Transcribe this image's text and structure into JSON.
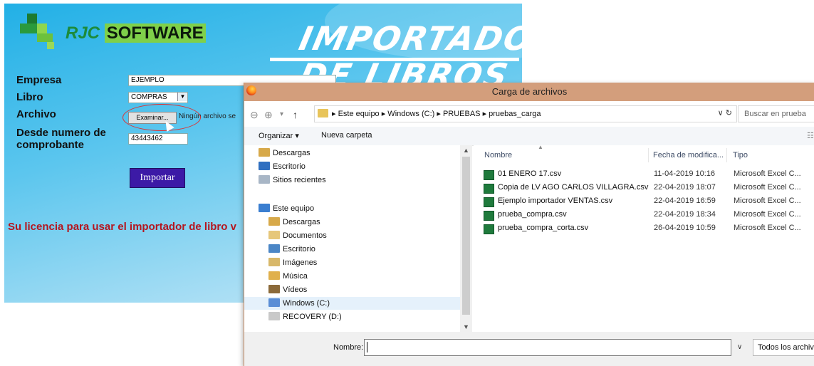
{
  "app": {
    "brand_rjc": "RJC",
    "brand_software": "SOFTWARE",
    "title_line1": "IMPORTADOR",
    "title_line2": "DE LIBROS",
    "labels": {
      "empresa": "Empresa",
      "libro": "Libro",
      "archivo": "Archivo",
      "desde1": "Desde numero de",
      "desde2": "comprobante"
    },
    "empresa_value": "EJEMPLO",
    "libro_value": "COMPRAS",
    "examinar_label": "Examinar...",
    "archivo_status": "Ningún archivo se",
    "comprobante_value": "43443462",
    "importar_label": "Importar",
    "license_text": "Su licencia para usar el importador de libro v"
  },
  "dialog": {
    "title": "Carga de archivos",
    "breadcrumb": "▸  Este equipo  ▸  Windows (C:)  ▸  PRUEBAS  ▸  pruebas_carga",
    "search_placeholder": "Buscar en prueba",
    "toolbar": {
      "organizar": "Organizar ▾",
      "nueva_carpeta": "Nueva carpeta"
    },
    "nav_items": [
      {
        "label": "Descargas",
        "icon": "download-folder-icon"
      },
      {
        "label": "Escritorio",
        "icon": "desktop-icon"
      },
      {
        "label": "Sitios recientes",
        "icon": "recent-places-icon"
      },
      {
        "label": "Este equipo",
        "icon": "computer-icon"
      },
      {
        "label": "Descargas",
        "icon": "download-folder-icon"
      },
      {
        "label": "Documentos",
        "icon": "documents-icon"
      },
      {
        "label": "Escritorio",
        "icon": "desktop-folder-icon"
      },
      {
        "label": "Imágenes",
        "icon": "pictures-icon"
      },
      {
        "label": "Música",
        "icon": "music-icon"
      },
      {
        "label": "Vídeos",
        "icon": "videos-icon"
      },
      {
        "label": "Windows (C:)",
        "icon": "windows-drive-icon"
      },
      {
        "label": "RECOVERY (D:)",
        "icon": "drive-icon"
      }
    ],
    "columns": {
      "nombre": "Nombre",
      "fecha": "Fecha de modifica...",
      "tipo": "Tipo"
    },
    "files": [
      {
        "name": "01 ENERO 17.csv",
        "date": "11-04-2019 10:16",
        "type": "Microsoft Excel C..."
      },
      {
        "name": "Copia de LV AGO CARLOS VILLAGRA.csv",
        "date": "22-04-2019 18:07",
        "type": "Microsoft Excel C..."
      },
      {
        "name": "Ejemplo importador VENTAS.csv",
        "date": "22-04-2019 16:59",
        "type": "Microsoft Excel C..."
      },
      {
        "name": "prueba_compra.csv",
        "date": "22-04-2019 18:34",
        "type": "Microsoft Excel C..."
      },
      {
        "name": "prueba_compra_corta.csv",
        "date": "26-04-2019 10:59",
        "type": "Microsoft Excel C..."
      }
    ],
    "nombre_label": "Nombre:",
    "filter_label": "Todos los archiv",
    "colors": {
      "titlebar": "#d39e7c",
      "accent": "#22b0e6"
    }
  }
}
